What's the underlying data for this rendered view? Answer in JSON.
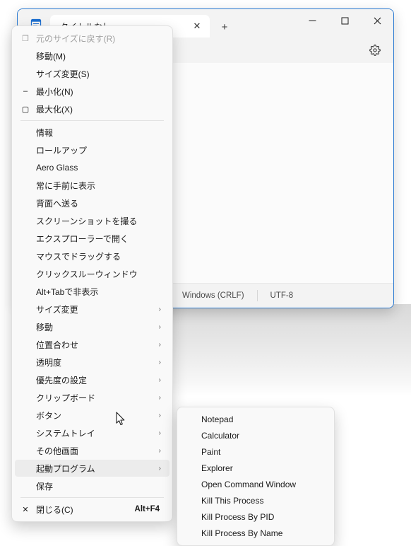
{
  "window": {
    "app_icon": "notepad-icon",
    "tab": {
      "title": "タイトルなし",
      "close_label": "✕",
      "new_tab_label": "+"
    },
    "controls": {
      "minimize": "—",
      "maximize": "▢",
      "close": "✕"
    },
    "toolbar": {
      "settings_icon": "gear-icon"
    },
    "statusbar": {
      "line_ending": "Windows (CRLF)",
      "encoding": "UTF-8"
    }
  },
  "system_menu": {
    "items": [
      {
        "icon": "restore-icon",
        "icon_glyph": "❐",
        "label": "元のサイズに戻す(R)",
        "accel": "",
        "submenu": false,
        "disabled": true,
        "highlight": false
      },
      {
        "icon": "",
        "icon_glyph": "",
        "label": "移動(M)",
        "accel": "",
        "submenu": false,
        "disabled": false,
        "highlight": false
      },
      {
        "icon": "",
        "icon_glyph": "",
        "label": "サイズ変更(S)",
        "accel": "",
        "submenu": false,
        "disabled": false,
        "highlight": false
      },
      {
        "icon": "minimize-icon",
        "icon_glyph": "–",
        "label": "最小化(N)",
        "accel": "",
        "submenu": false,
        "disabled": false,
        "highlight": false
      },
      {
        "icon": "maximize-icon",
        "icon_glyph": "▢",
        "label": "最大化(X)",
        "accel": "",
        "submenu": false,
        "disabled": false,
        "highlight": false
      },
      {
        "separator": true
      },
      {
        "icon": "",
        "icon_glyph": "",
        "label": "情報",
        "accel": "",
        "submenu": false,
        "disabled": false,
        "highlight": false
      },
      {
        "icon": "",
        "icon_glyph": "",
        "label": "ロールアップ",
        "accel": "",
        "submenu": false,
        "disabled": false,
        "highlight": false
      },
      {
        "icon": "",
        "icon_glyph": "",
        "label": "Aero Glass",
        "accel": "",
        "submenu": false,
        "disabled": false,
        "highlight": false
      },
      {
        "icon": "",
        "icon_glyph": "",
        "label": "常に手前に表示",
        "accel": "",
        "submenu": false,
        "disabled": false,
        "highlight": false
      },
      {
        "icon": "",
        "icon_glyph": "",
        "label": "背面へ送る",
        "accel": "",
        "submenu": false,
        "disabled": false,
        "highlight": false
      },
      {
        "icon": "",
        "icon_glyph": "",
        "label": "スクリーンショットを撮る",
        "accel": "",
        "submenu": false,
        "disabled": false,
        "highlight": false
      },
      {
        "icon": "",
        "icon_glyph": "",
        "label": "エクスプローラーで開く",
        "accel": "",
        "submenu": false,
        "disabled": false,
        "highlight": false
      },
      {
        "icon": "",
        "icon_glyph": "",
        "label": "マウスでドラッグする",
        "accel": "",
        "submenu": false,
        "disabled": false,
        "highlight": false
      },
      {
        "icon": "",
        "icon_glyph": "",
        "label": "クリックスルーウィンドウ",
        "accel": "",
        "submenu": false,
        "disabled": false,
        "highlight": false
      },
      {
        "icon": "",
        "icon_glyph": "",
        "label": "Alt+Tabで非表示",
        "accel": "",
        "submenu": false,
        "disabled": false,
        "highlight": false
      },
      {
        "icon": "",
        "icon_glyph": "",
        "label": "サイズ変更",
        "accel": "",
        "submenu": true,
        "disabled": false,
        "highlight": false
      },
      {
        "icon": "",
        "icon_glyph": "",
        "label": "移動",
        "accel": "",
        "submenu": true,
        "disabled": false,
        "highlight": false
      },
      {
        "icon": "",
        "icon_glyph": "",
        "label": "位置合わせ",
        "accel": "",
        "submenu": true,
        "disabled": false,
        "highlight": false
      },
      {
        "icon": "",
        "icon_glyph": "",
        "label": "透明度",
        "accel": "",
        "submenu": true,
        "disabled": false,
        "highlight": false
      },
      {
        "icon": "",
        "icon_glyph": "",
        "label": "優先度の設定",
        "accel": "",
        "submenu": true,
        "disabled": false,
        "highlight": false
      },
      {
        "icon": "",
        "icon_glyph": "",
        "label": "クリップボード",
        "accel": "",
        "submenu": true,
        "disabled": false,
        "highlight": false
      },
      {
        "icon": "",
        "icon_glyph": "",
        "label": "ボタン",
        "accel": "",
        "submenu": true,
        "disabled": false,
        "highlight": false
      },
      {
        "icon": "",
        "icon_glyph": "",
        "label": "システムトレイ",
        "accel": "",
        "submenu": true,
        "disabled": false,
        "highlight": false
      },
      {
        "icon": "",
        "icon_glyph": "",
        "label": "その他画面",
        "accel": "",
        "submenu": true,
        "disabled": false,
        "highlight": false
      },
      {
        "icon": "",
        "icon_glyph": "",
        "label": "起動プログラム",
        "accel": "",
        "submenu": true,
        "disabled": false,
        "highlight": true
      },
      {
        "icon": "",
        "icon_glyph": "",
        "label": "保存",
        "accel": "",
        "submenu": false,
        "disabled": false,
        "highlight": false
      },
      {
        "separator": true
      },
      {
        "icon": "close-icon",
        "icon_glyph": "✕",
        "label": "閉じる(C)",
        "accel": "Alt+F4",
        "submenu": false,
        "disabled": false,
        "highlight": false
      }
    ]
  },
  "program_submenu": {
    "items": [
      {
        "label": "Notepad"
      },
      {
        "label": "Calculator"
      },
      {
        "label": "Paint"
      },
      {
        "label": "Explorer"
      },
      {
        "label": "Open Command Window"
      },
      {
        "label": "Kill This Process"
      },
      {
        "label": "Kill Process By PID"
      },
      {
        "label": "Kill Process By Name"
      }
    ]
  },
  "colors": {
    "accent_border": "#2a7ad2",
    "menu_bg": "#f9f9f9",
    "highlight_bg": "#ececec",
    "window_bg": "#f3f3f3"
  }
}
